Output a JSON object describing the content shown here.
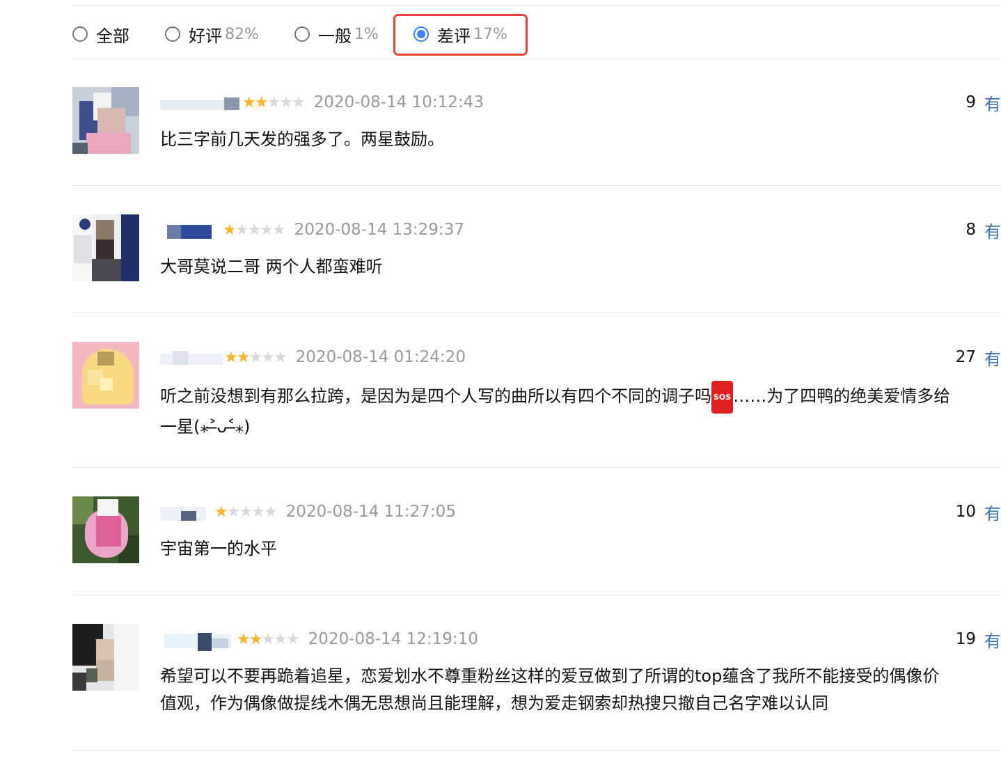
{
  "filters": {
    "options": [
      {
        "label": "全部",
        "pct": "",
        "checked": false
      },
      {
        "label": "好评",
        "pct": "82%",
        "checked": false
      },
      {
        "label": "一般",
        "pct": "1%",
        "checked": false
      },
      {
        "label": "差评",
        "pct": "17%",
        "checked": true
      }
    ]
  },
  "comments": [
    {
      "stars": 2,
      "timestamp": "2020-08-14 10:12:43",
      "votes": "9",
      "useful_label": "有用",
      "lines": [
        "比三字前几天发的强多了。两星鼓励。"
      ]
    },
    {
      "stars": 1,
      "timestamp": "2020-08-14 13:29:37",
      "votes": "8",
      "useful_label": "有用",
      "lines": [
        "大哥莫说二哥 两个人都蛮难听"
      ]
    },
    {
      "stars": 2,
      "timestamp": "2020-08-14 01:24:20",
      "votes": "27",
      "useful_label": "有用",
      "line1_before": "听之前没想到有那么拉跨，是因为是四个人写的曲所以有四个不同的调子吗",
      "sos_label": "SOS",
      "line1_after": "……为了四鸭的绝美爱情多给",
      "line2": "一星(⁎˃̶ᴗ˂̶⁎)"
    },
    {
      "stars": 1,
      "timestamp": "2020-08-14 11:27:05",
      "votes": "10",
      "useful_label": "有用",
      "lines": [
        "宇宙第一的水平"
      ]
    },
    {
      "stars": 2,
      "timestamp": "2020-08-14 12:19:10",
      "votes": "19",
      "useful_label": "有用",
      "lines": [
        "希望可以不要再跪着追星，恋爱划水不尊重粉丝这样的爱豆做到了所谓的top蕴含了我所不能接受的偶像价",
        "值观，作为偶像做提线木偶无思想尚且能理解，想为爱走钢索却热搜只撤自己名字难以认同"
      ]
    }
  ],
  "icons": {
    "star_filled": "star-filled-icon",
    "star_empty": "star-empty-icon",
    "sos": "sos-emoji-icon"
  },
  "colors": {
    "star": "#f7b529",
    "star_empty": "#d8d8d8",
    "timestamp": "#999999",
    "link": "#3a72b4",
    "radio_checked": "#3b82f6",
    "highlight": "#e34234"
  }
}
